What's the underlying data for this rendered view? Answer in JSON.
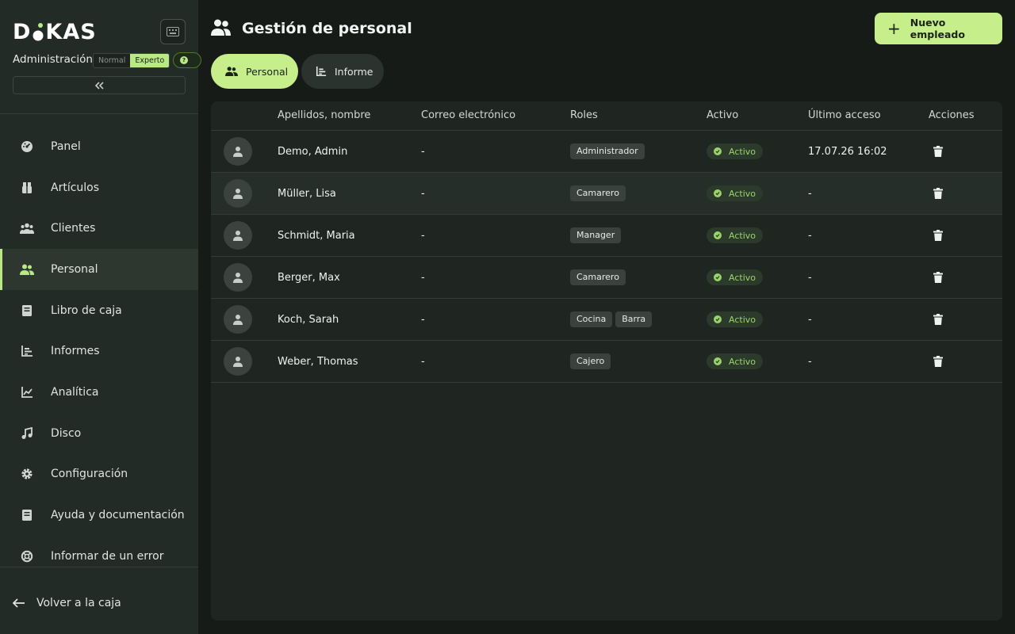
{
  "sidebar": {
    "logo": "DKAS",
    "admin_label": "Administración",
    "mode_normal": "Normal",
    "mode_expert": "Experto",
    "nav": [
      {
        "label": "Panel",
        "icon": "dashboard-icon"
      },
      {
        "label": "Artículos",
        "icon": "articles-icon"
      },
      {
        "label": "Clientes",
        "icon": "customers-icon"
      },
      {
        "label": "Personal",
        "icon": "staff-icon"
      },
      {
        "label": "Libro de caja",
        "icon": "cashbook-icon"
      },
      {
        "label": "Informes",
        "icon": "reports-icon"
      },
      {
        "label": "Analítica",
        "icon": "analytics-icon"
      },
      {
        "label": "Disco",
        "icon": "music-note-icon"
      },
      {
        "label": "Configuración",
        "icon": "gear-icon"
      },
      {
        "label": "Ayuda y documentación",
        "icon": "book-icon"
      },
      {
        "label": "Informar de un error",
        "icon": "lifebuoy-icon"
      }
    ],
    "active_item": "Personal",
    "back_label": "Volver a la caja"
  },
  "header": {
    "title": "Gestión de personal",
    "new_button": "Nuevo empleado"
  },
  "tabs": [
    {
      "label": "Personal",
      "active": true
    },
    {
      "label": "Informe",
      "active": false
    }
  ],
  "table": {
    "columns": [
      "Apellidos, nombre",
      "Correo electrónico",
      "Roles",
      "Activo",
      "Último acceso",
      "Acciones"
    ],
    "rows": [
      {
        "name": "Demo, Admin",
        "email": "-",
        "roles": [
          "Administrador"
        ],
        "status": "Activo",
        "last_access": "17.07.26 16:02"
      },
      {
        "name": "Müller, Lisa",
        "email": "-",
        "roles": [
          "Camarero"
        ],
        "status": "Activo",
        "last_access": "-"
      },
      {
        "name": "Schmidt, Maria",
        "email": "-",
        "roles": [
          "Manager"
        ],
        "status": "Activo",
        "last_access": "-"
      },
      {
        "name": "Berger, Max",
        "email": "-",
        "roles": [
          "Camarero"
        ],
        "status": "Activo",
        "last_access": "-"
      },
      {
        "name": "Koch, Sarah",
        "email": "-",
        "roles": [
          "Cocina",
          "Barra"
        ],
        "status": "Activo",
        "last_access": "-"
      },
      {
        "name": "Weber, Thomas",
        "email": "-",
        "roles": [
          "Cajero"
        ],
        "status": "Activo",
        "last_access": "-"
      }
    ]
  },
  "colors": {
    "accent": "#c6ee8a",
    "background": "#161b18",
    "sidebar": "#232b26",
    "status_green": "#9bd36b"
  }
}
